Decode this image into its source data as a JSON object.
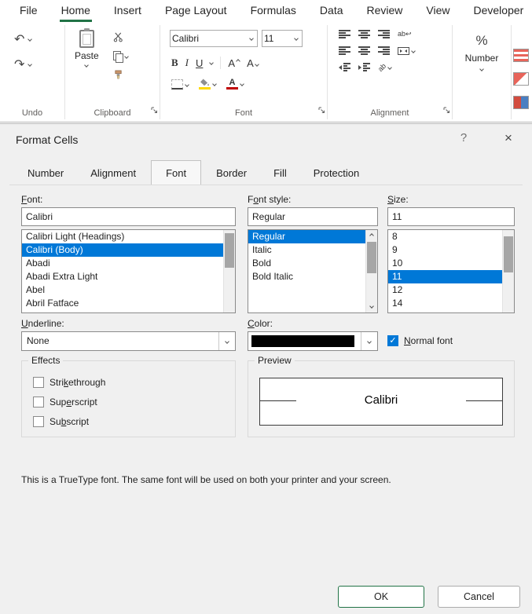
{
  "ribbon": {
    "tabs": [
      "File",
      "Home",
      "Insert",
      "Page Layout",
      "Formulas",
      "Data",
      "Review",
      "View",
      "Developer"
    ],
    "active_tab": "Home",
    "accent_green": "#217346",
    "selection_blue": "#0078d7",
    "icons": {
      "undo_glyph": "↶",
      "redo_glyph": "↷",
      "wrap_return": "↩"
    },
    "groups": {
      "undo": {
        "label": "Undo"
      },
      "clipboard": {
        "label": "Clipboard",
        "paste_label": "Paste"
      },
      "font": {
        "label": "Font",
        "name_value": "Calibri",
        "size_value": "11",
        "bold": "B",
        "italic": "I",
        "underline": "U",
        "grow": "A",
        "shrink": "A",
        "fill_color": "#ffd800",
        "font_color": "#c00000"
      },
      "alignment": {
        "label": "Alignment",
        "wrap_text": "ab",
        "orientation": "ab"
      },
      "number": {
        "label": "Number",
        "percent": "%"
      }
    }
  },
  "dialog": {
    "title": "Format Cells",
    "help_glyph": "?",
    "close_glyph": "×",
    "tabs": [
      "Number",
      "Alignment",
      "Font",
      "Border",
      "Fill",
      "Protection"
    ],
    "active_tab": "Font",
    "font": {
      "label_mn": "F",
      "label_rest": "ont:",
      "value": "Calibri",
      "options": [
        "Calibri Light (Headings)",
        "Calibri (Body)",
        "Abadi",
        "Abadi Extra Light",
        "Abel",
        "Abril Fatface"
      ],
      "selected": "Calibri (Body)"
    },
    "style": {
      "label_pre": "F",
      "label_mn": "o",
      "label_rest": "nt style:",
      "value": "Regular",
      "options": [
        "Regular",
        "Italic",
        "Bold",
        "Bold Italic"
      ],
      "selected": "Regular"
    },
    "size": {
      "label_mn": "S",
      "label_rest": "ize:",
      "value": "11",
      "options": [
        "8",
        "9",
        "10",
        "11",
        "12",
        "14"
      ],
      "selected": "11"
    },
    "underline": {
      "label_mn": "U",
      "label_rest": "nderline:",
      "value": "None"
    },
    "color": {
      "label_mn": "C",
      "label_rest": "olor:",
      "swatch": "#000000"
    },
    "normal_font": {
      "label_mn": "N",
      "label_rest": "ormal font",
      "checked": true,
      "check_glyph": "✓"
    },
    "effects": {
      "label": "Effects",
      "items": [
        {
          "pre": "Stri",
          "mn": "k",
          "rest": "ethrough",
          "checked": false
        },
        {
          "pre": "Sup",
          "mn": "e",
          "rest": "rscript",
          "checked": false
        },
        {
          "pre": "Su",
          "mn": "b",
          "rest": "script",
          "checked": false
        }
      ]
    },
    "preview": {
      "label": "Preview",
      "text": "Calibri"
    },
    "note": "This is a TrueType font.  The same font will be used on both your printer and your screen.",
    "ok_label": "OK",
    "cancel_label": "Cancel"
  }
}
